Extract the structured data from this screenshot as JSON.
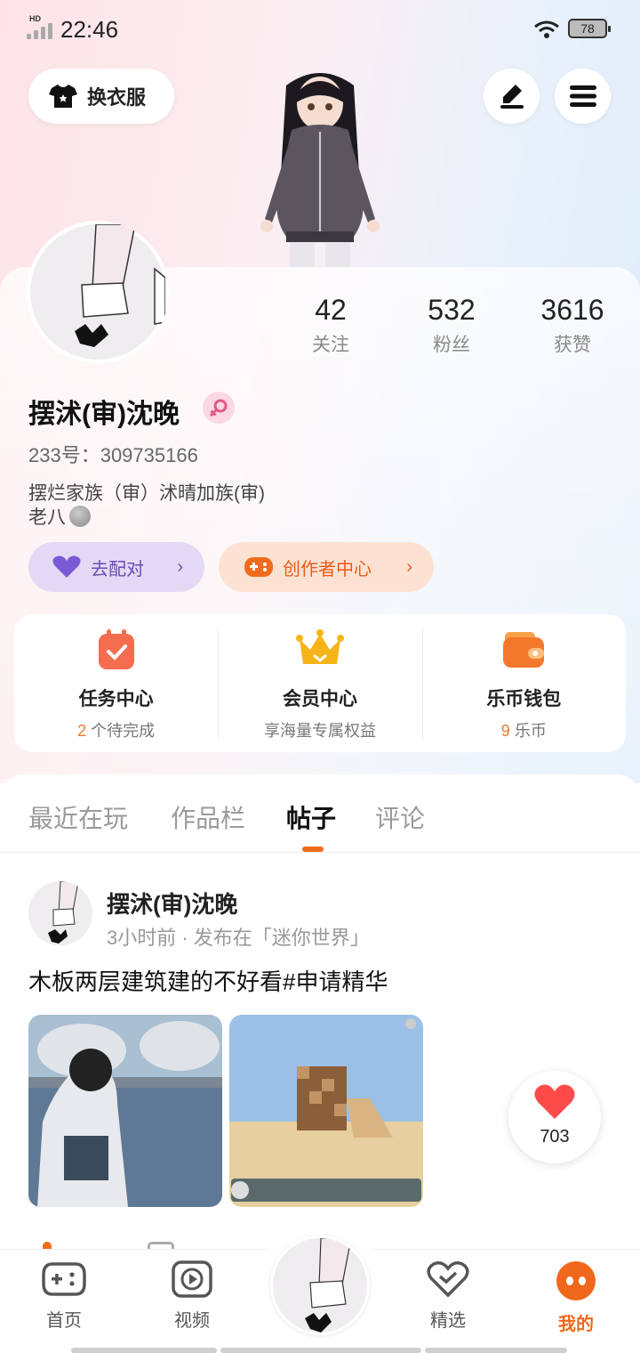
{
  "status_bar": {
    "time": "22:46",
    "network_badge": "HD",
    "battery": "78"
  },
  "top": {
    "dress_label": "换衣服",
    "edit_icon": "pencil-icon",
    "menu_icon": "menu-icon"
  },
  "stats": [
    {
      "value": "42",
      "label": "关注"
    },
    {
      "value": "532",
      "label": "粉丝"
    },
    {
      "value": "3616",
      "label": "获赞"
    }
  ],
  "profile": {
    "name": "摆沭(审)沈晚",
    "id_line": "233号：309735166",
    "bio_line1": "摆烂家族（审）沭晴加族(审)",
    "bio_line2": "老八",
    "gender": "female"
  },
  "actions": {
    "match_label": "去配对",
    "creator_label": "创作者中心"
  },
  "quick": [
    {
      "title": "任务中心",
      "highlight": "2",
      "sub": " 个待完成"
    },
    {
      "title": "会员中心",
      "highlight": "",
      "sub": "享海量专属权益"
    },
    {
      "title": "乐币钱包",
      "highlight": "9",
      "sub": " 乐币"
    }
  ],
  "tabs": [
    "最近在玩",
    "作品栏",
    "帖子",
    "评论"
  ],
  "active_tab": "帖子",
  "post": {
    "author": "摆沭(审)沈晚",
    "meta": "3小时前 · 发布在「迷你世界」",
    "text": "木板两层建筑建的不好看#申请精华",
    "likes": "703"
  },
  "nav": [
    {
      "label": "首页",
      "icon": "gamepad-icon"
    },
    {
      "label": "视频",
      "icon": "play-icon"
    },
    {
      "label": "精选",
      "icon": "heart-check-icon"
    },
    {
      "label": "我的",
      "icon": "me-icon"
    }
  ],
  "colors": {
    "accent": "#f06c1c",
    "match_purple": "#6a4bb3"
  }
}
